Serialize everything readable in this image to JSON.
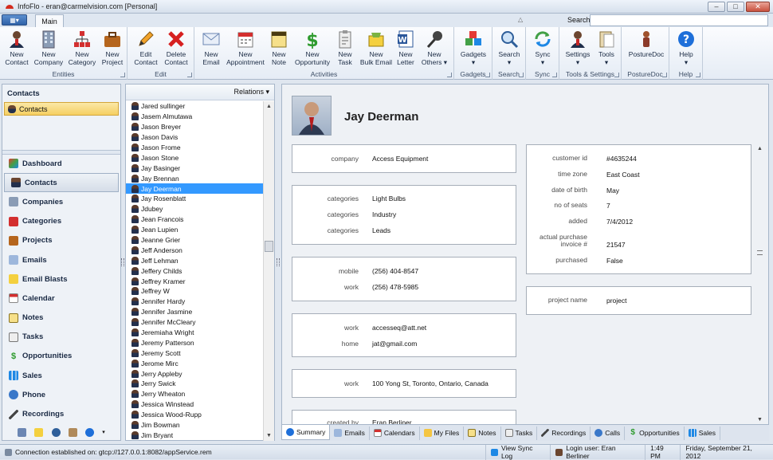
{
  "window": {
    "title": "InfoFlo - eran@carmelvision.com [Personal]",
    "minimize": "–",
    "maximize": "□",
    "close": "✕"
  },
  "ribbon_tabs": {
    "main": "Main"
  },
  "search": {
    "label": "Search",
    "value": ""
  },
  "ribbon": {
    "entities": {
      "label": "Entities",
      "buttons": [
        {
          "line1": "New",
          "line2": "Contact"
        },
        {
          "line1": "New",
          "line2": "Company"
        },
        {
          "line1": "New",
          "line2": "Category"
        },
        {
          "line1": "New",
          "line2": "Project"
        }
      ]
    },
    "edit": {
      "label": "Edit",
      "buttons": [
        {
          "line1": "Edit",
          "line2": "Contact"
        },
        {
          "line1": "Delete",
          "line2": "Contact"
        }
      ]
    },
    "activities": {
      "label": "Activities",
      "buttons": [
        {
          "line1": "New",
          "line2": "Email"
        },
        {
          "line1": "New",
          "line2": "Appointment"
        },
        {
          "line1": "New",
          "line2": "Note"
        },
        {
          "line1": "New",
          "line2": "Opportunity"
        },
        {
          "line1": "New",
          "line2": "Task"
        },
        {
          "line1": "New",
          "line2": "Bulk Email"
        },
        {
          "line1": "New",
          "line2": "Letter"
        },
        {
          "line1": "New",
          "line2": "Others ▾"
        }
      ]
    },
    "gadgets": {
      "label": "Gadgets",
      "button": "Gadgets",
      "arrow": "▾"
    },
    "search": {
      "label": "Search",
      "button": "Search",
      "arrow": "▾"
    },
    "sync": {
      "label": "Sync",
      "button": "Sync",
      "arrow": "▾"
    },
    "tools_settings": {
      "label": "Tools & Settings",
      "settings": "Settings",
      "tools": "Tools",
      "arrow": "▾"
    },
    "posturedoc": {
      "label": "PostureDoc",
      "button": "PostureDoc"
    },
    "help": {
      "label": "Help",
      "button": "Help",
      "arrow": "▾"
    }
  },
  "nav": {
    "header": "Contacts",
    "folder": "Contacts",
    "items": [
      "Dashboard",
      "Contacts",
      "Companies",
      "Categories",
      "Projects",
      "Emails",
      "Email Blasts",
      "Calendar",
      "Notes",
      "Tasks",
      "Opportunities",
      "Sales",
      "Phone",
      "Recordings"
    ]
  },
  "list": {
    "relations": "Relations ▾",
    "contacts": [
      "Jared sullinger",
      "Jasem Almutawa",
      "Jason Breyer",
      "Jason Davis",
      "Jason Frome",
      "Jason Stone",
      "Jay Basinger",
      "Jay Brennan",
      "Jay Deerman",
      "Jay Rosenblatt",
      "Jdubey",
      "Jean Francois",
      "Jean Lupien",
      "Jeanne Grier",
      "Jeff Anderson",
      "Jeff Lehman",
      "Jeffery Childs",
      "Jeffrey Kramer",
      "Jeffrey W",
      "Jennifer Hardy",
      "Jennifer Jasmine",
      "Jennifer McCleary",
      "Jeremiaha Wright",
      "Jeremy Patterson",
      "Jeremy Scott",
      "Jerome Mirc",
      "Jerry Appleby",
      "Jerry Swick",
      "Jerry Wheaton",
      "Jessica Winstead",
      "Jessica Wood-Rupp",
      "Jim Bowman",
      "Jim Bryant"
    ]
  },
  "detail": {
    "name": "Jay Deerman",
    "company": {
      "label": "company",
      "value": "Access Equipment"
    },
    "categories": [
      {
        "label": "categories",
        "value": "Light Bulbs"
      },
      {
        "label": "categories",
        "value": "Industry"
      },
      {
        "label": "categories",
        "value": "Leads"
      }
    ],
    "phones": [
      {
        "label": "mobile",
        "value": "(256) 404-8547"
      },
      {
        "label": "work",
        "value": "(256) 478-5985"
      }
    ],
    "emails": [
      {
        "label": "work",
        "value": "accesseq@att.net"
      },
      {
        "label": "home",
        "value": "jat@gmail.com"
      }
    ],
    "address": {
      "label": "work",
      "value": "100 Yong St, Toronto, Ontario, Canada"
    },
    "created_by": {
      "label": "created by",
      "value": "Eran Berliner"
    },
    "info": [
      {
        "label": "customer id",
        "value": "#4635244"
      },
      {
        "label": "time zone",
        "value": "East Coast"
      },
      {
        "label": "date of birth",
        "value": "May"
      },
      {
        "label": "no of seats",
        "value": "7"
      },
      {
        "label": "added",
        "value": "7/4/2012"
      },
      {
        "label": "actual purchase invoice #",
        "value": "21547"
      },
      {
        "label": "purchased",
        "value": "False"
      }
    ],
    "project": {
      "label": "project name",
      "value": "project"
    }
  },
  "bottom_tabs": [
    "Summary",
    "Emails",
    "Calendars",
    "My Files",
    "Notes",
    "Tasks",
    "Recordings",
    "Calls",
    "Opportunities",
    "Sales"
  ],
  "status": {
    "connection": "Connection established on: gtcp://127.0.0.1:8082/appService.rem",
    "sync_log": "View Sync Log",
    "login": "Login user: Eran Berliner",
    "time": "1:49 PM",
    "date": "Friday, September 21, 2012"
  },
  "colors": {
    "accent": "#3399ff",
    "folder_highlight": "#f5cf62"
  }
}
